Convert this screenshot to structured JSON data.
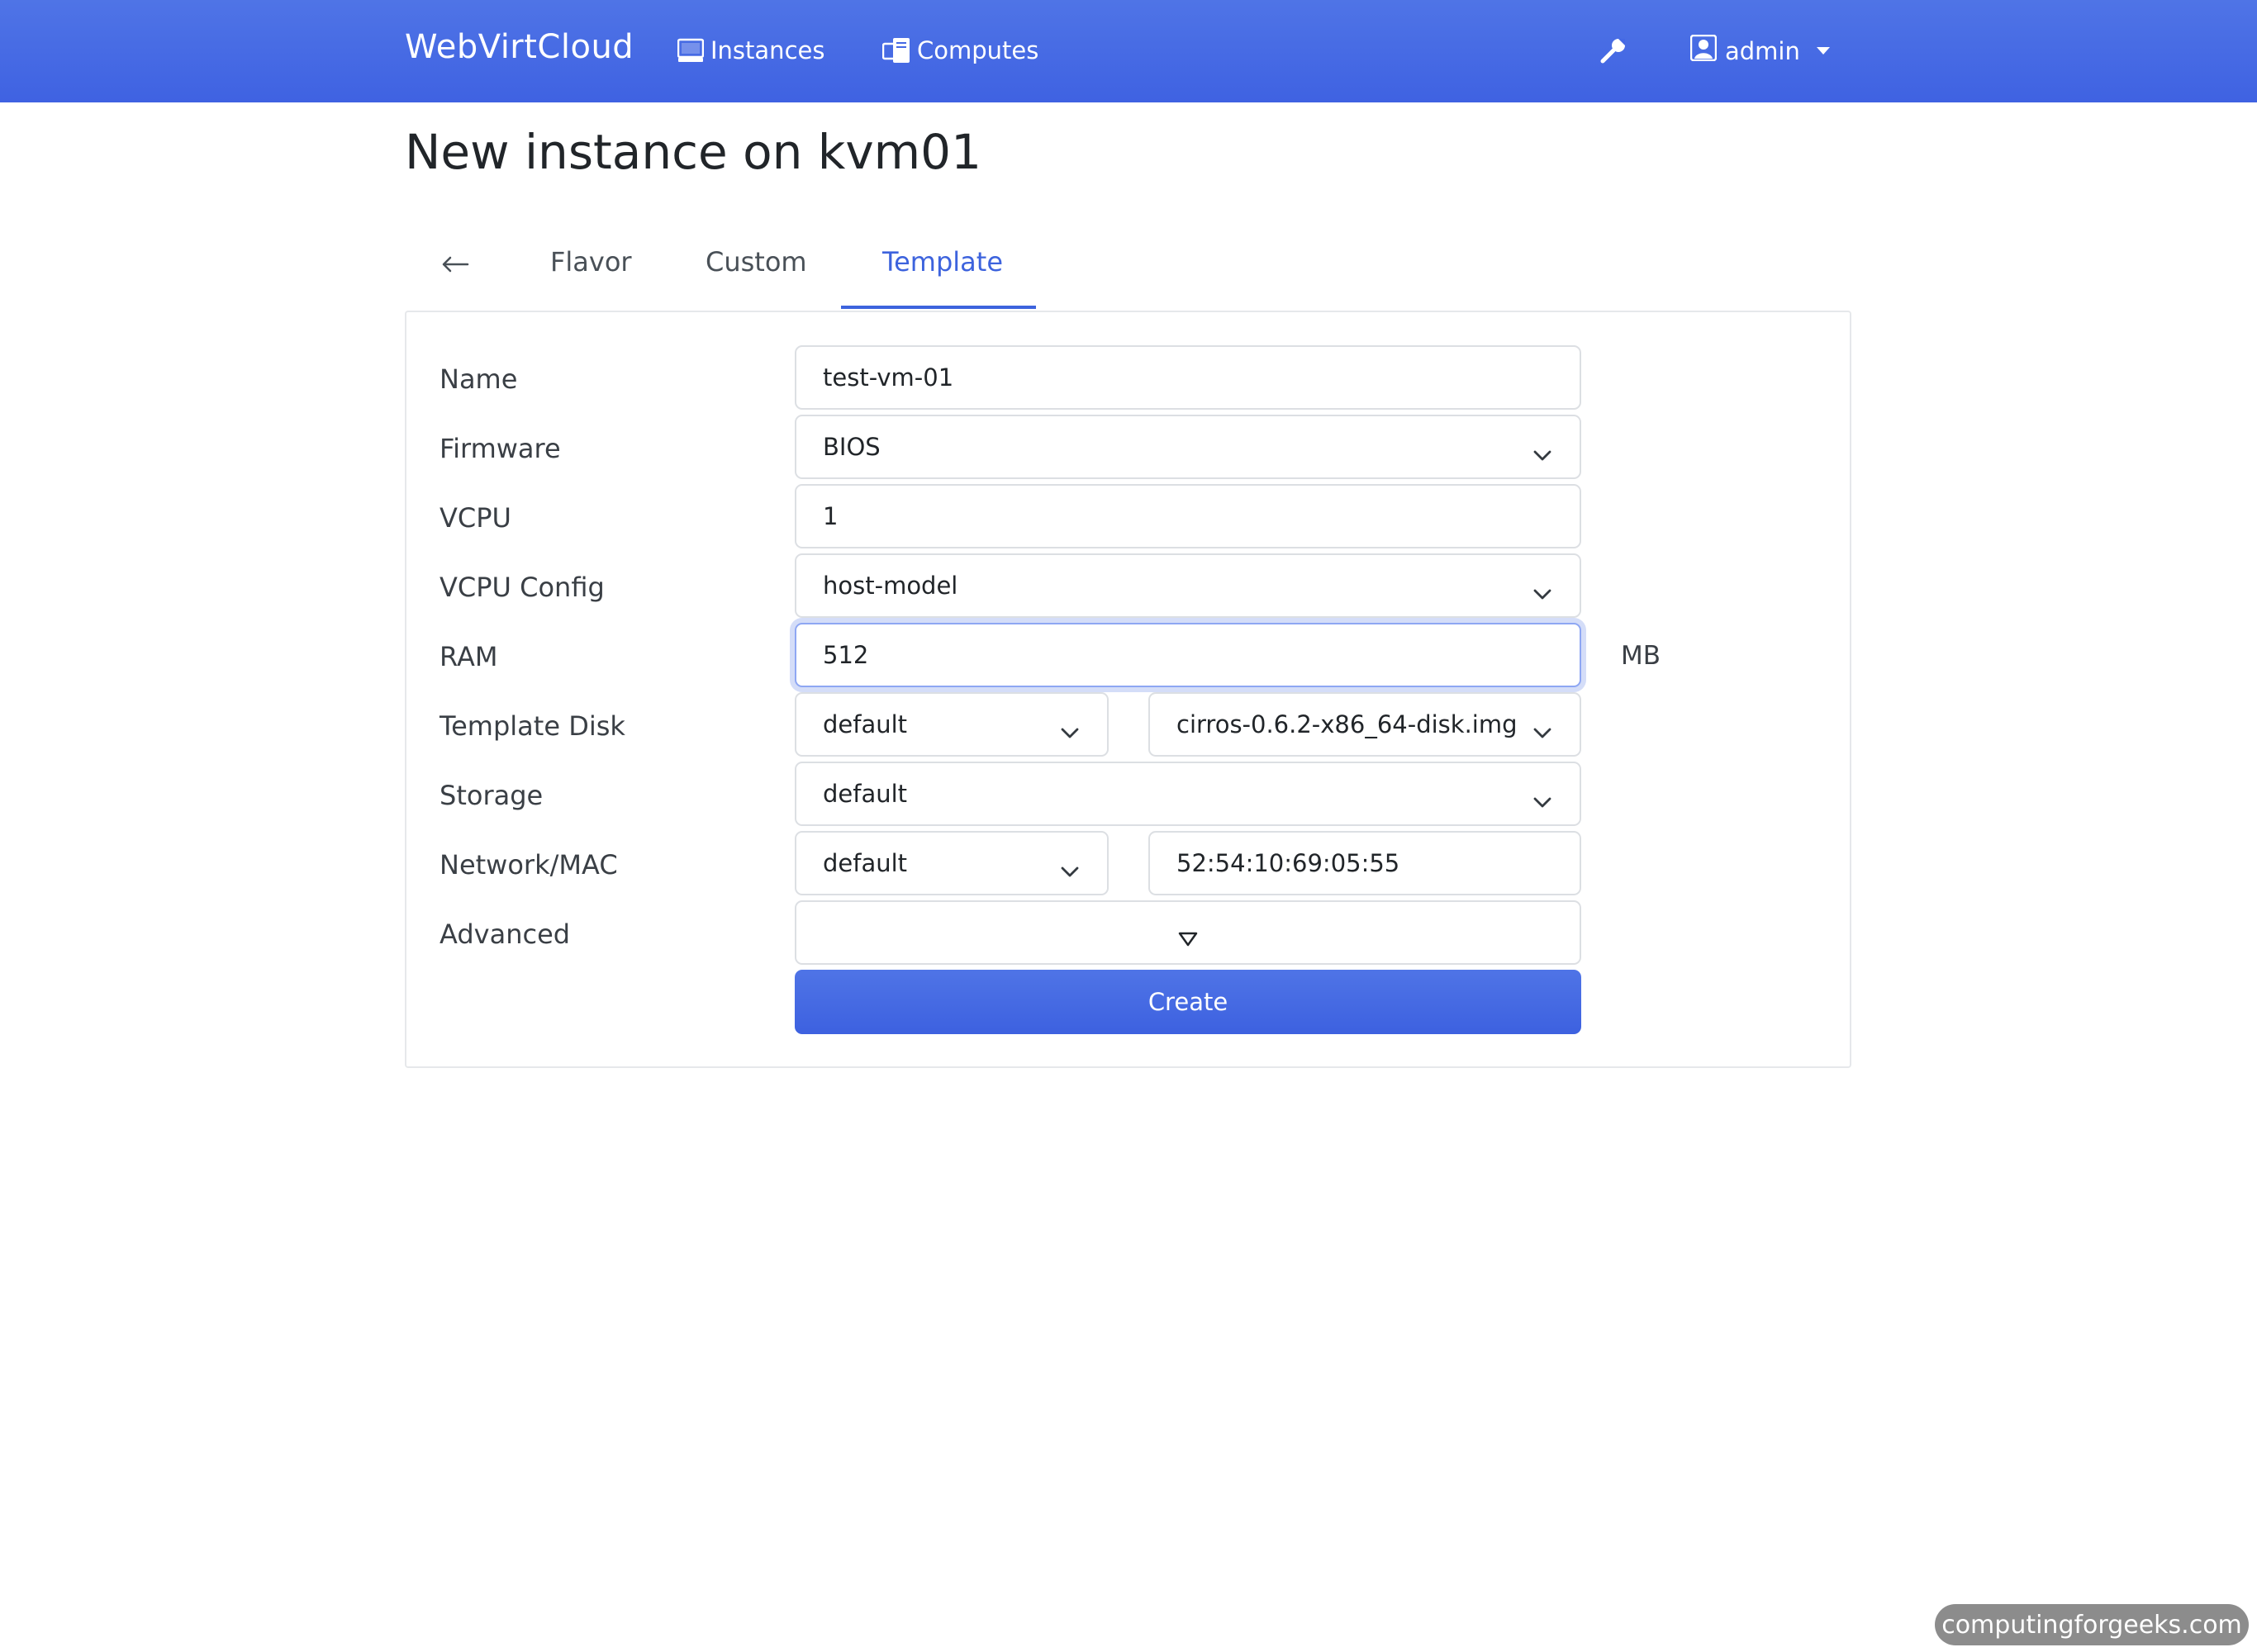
{
  "navbar": {
    "brand": "WebVirtCloud",
    "instances_label": "Instances",
    "computes_label": "Computes",
    "user_label": "admin",
    "bg_color": "#4468e4"
  },
  "page": {
    "title": "New instance on kvm01"
  },
  "tabs": {
    "back_glyph": "←",
    "items": [
      {
        "label": "Flavor"
      },
      {
        "label": "Custom"
      },
      {
        "label": "Template",
        "active": true
      }
    ]
  },
  "form": {
    "name": {
      "label": "Name",
      "value": "test-vm-01"
    },
    "firmware": {
      "label": "Firmware",
      "value": "BIOS"
    },
    "vcpu": {
      "label": "VCPU",
      "value": "1"
    },
    "vcpu_config": {
      "label": "VCPU Config",
      "value": "host-model"
    },
    "ram": {
      "label": "RAM",
      "value": "512",
      "unit": "MB"
    },
    "template_disk": {
      "label": "Template Disk",
      "pool": "default",
      "image": "cirros-0.6.2-x86_64-disk.img"
    },
    "storage": {
      "label": "Storage",
      "value": "default"
    },
    "network": {
      "label": "Network/MAC",
      "network": "default",
      "mac": "52:54:10:69:05:55"
    },
    "advanced": {
      "label": "Advanced"
    },
    "create_label": "Create"
  },
  "watermark": "computingforgeeks.com",
  "colors": {
    "accent": "#3d63dd",
    "focus": "#8ea7f3"
  }
}
